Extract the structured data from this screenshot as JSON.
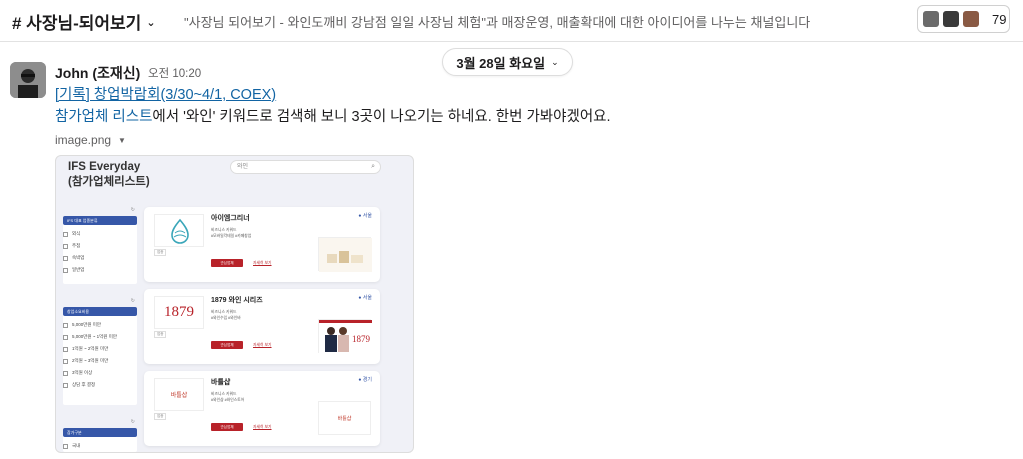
{
  "header": {
    "channel_name": "# 사장님-되어보기",
    "topic": "\"사장님 되어보기 - 와인도깨비 강남점 일일 사장님 체험\"과 매장운영, 매출확대에 대한 아이디어를 나누는 채널입니다",
    "member_count": "79"
  },
  "date_divider": {
    "label": "3월 28일 화요일"
  },
  "message": {
    "sender": "John (조재신)",
    "time": "오전 10:20",
    "link_text": "[기록] 창업박람회(3/30~4/1, COEX)",
    "body_link": "참가업체 리스트",
    "body_text": "에서 '와인' 키워드로 검색해 보니 3곳이 나오기는 하네요. 한번 가봐야겠어요.",
    "file_name": "image.png"
  },
  "attachment": {
    "title_line1": "IFS Everyday",
    "title_line2": "(참가업체리스트)",
    "search_value": "와인",
    "filter_groups": [
      {
        "head": "IFS 대표 업종분류",
        "items": [
          "외식",
          "주점",
          "숙박업",
          "일반업"
        ]
      },
      {
        "head": "창업소요비용",
        "items": [
          "5,000만원 미만",
          "5,000만원 ~ 1억원 미만",
          "1억원 ~ 2억원 미만",
          "2억원 ~ 3억원 미만",
          "3억원 이상",
          "상담 후 결정"
        ]
      },
      {
        "head": "참가구분",
        "items": [
          "국내"
        ]
      }
    ],
    "cards": [
      {
        "name": "아이엠그리너",
        "region": "서울",
        "sub1": "비즈니스 키워드",
        "sub2": "#모바일칵테일 #카페창업",
        "logo_text": "",
        "logo_color": "#3aa6b9"
      },
      {
        "name": "1879 와인 시리즈",
        "region": "서울",
        "sub1": "비즈니스 키워드",
        "sub2": "#와인수입 #와인바",
        "logo_text": "1879",
        "logo_color": "#b82229"
      },
      {
        "name": "바틀샵",
        "region": "경기",
        "sub1": "비즈니스 키워드",
        "sub2": "#와인샵 #와인스토어",
        "logo_text": "바틀샵",
        "logo_color": "#c0392b"
      }
    ],
    "card_button": "관심업체",
    "card_link": "자세히 보기",
    "card_tag": "업종"
  },
  "colors": {
    "link": "#1264a3",
    "accent": "#3657a8",
    "red": "#b82229"
  }
}
